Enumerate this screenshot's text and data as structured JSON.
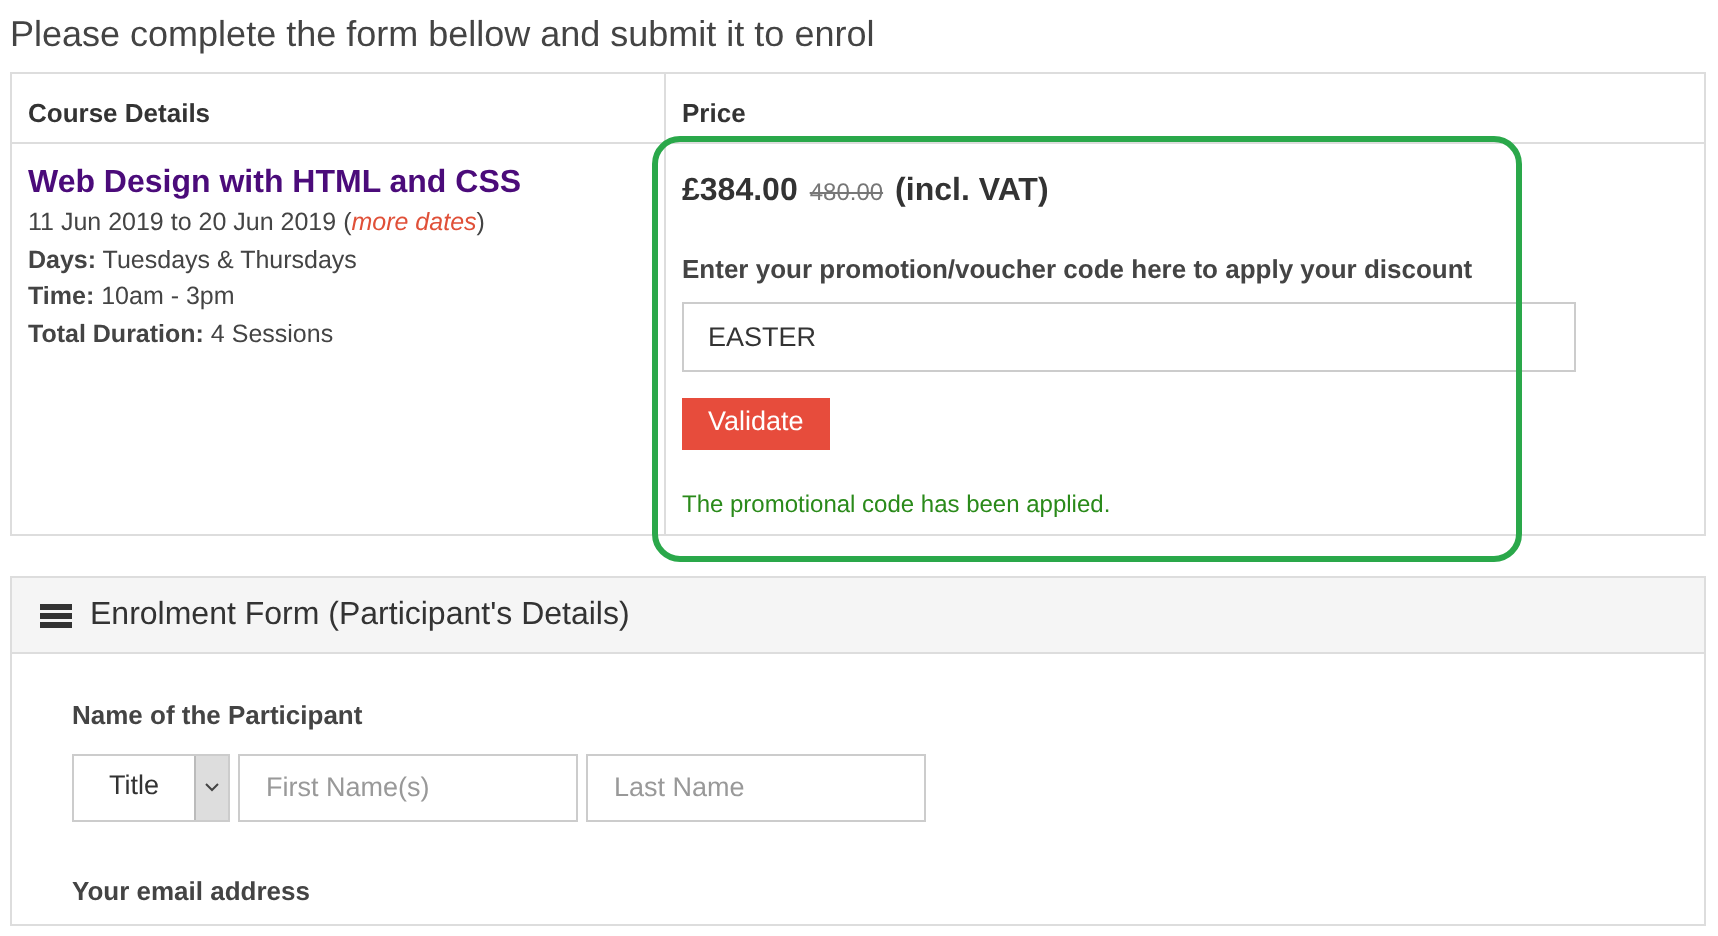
{
  "intro": "Please complete the form bellow and submit it to enrol",
  "table": {
    "columns": [
      "Course Details",
      "Price"
    ],
    "course": {
      "title": "Web Design with HTML and CSS",
      "dates": "11 Jun 2019 to 20 Jun 2019",
      "more_dates": "(*more dates*)",
      "details": [
        {
          "label": "Days:",
          "value": "Tuesdays & Thursdays"
        },
        {
          "label": "Time:",
          "value": "10am - 3pm"
        },
        {
          "label": "Total Duration:",
          "value": "4 Sessions"
        }
      ]
    },
    "price": {
      "current": "£384.00",
      "old": "480.00",
      "vat": "(incl. VAT)",
      "voucher_label": "Enter your promotion/voucher code here to apply your discount",
      "voucher_value": "EASTER",
      "button": "Validate",
      "message": "The promotional code has been applied."
    }
  },
  "panel": {
    "title": "Enrolment Form (Participant's Details)",
    "name_label": "Name of the Participant",
    "title_select": "Title",
    "first_placeholder": "First Name(s)",
    "last_placeholder": "Last Name",
    "email_label": "Your email address"
  }
}
